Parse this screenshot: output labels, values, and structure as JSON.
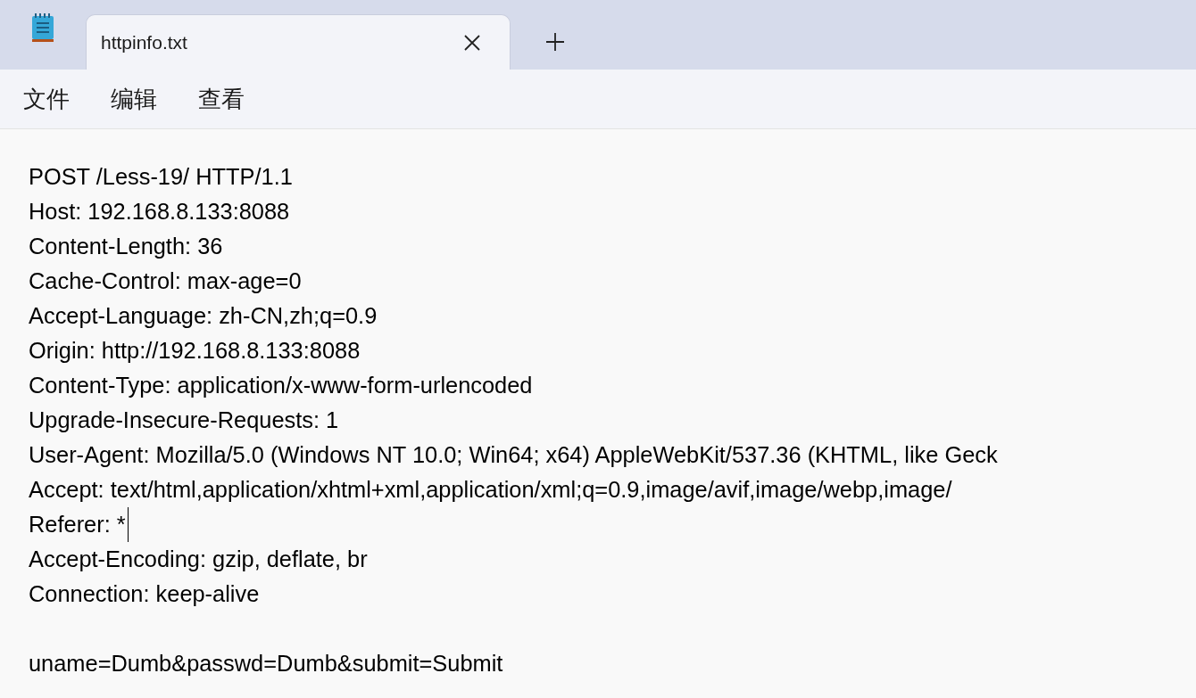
{
  "tabs": [
    {
      "title": "httpinfo.txt",
      "selected": true
    }
  ],
  "menu": [
    "文件",
    "编辑",
    "查看"
  ],
  "editor": {
    "header_lines": [
      {
        "text": "POST /Less-19/ HTTP/1.1",
        "cursor": false
      },
      {
        "text": "Host: 192.168.8.133:8088",
        "cursor": false
      },
      {
        "text": "Content-Length: 36",
        "cursor": false
      },
      {
        "text": "Cache-Control: max-age=0",
        "cursor": false
      },
      {
        "text": "Accept-Language: zh-CN,zh;q=0.9",
        "cursor": false
      },
      {
        "text": "Origin: http://192.168.8.133:8088",
        "cursor": false
      },
      {
        "text": "Content-Type: application/x-www-form-urlencoded",
        "cursor": false
      },
      {
        "text": "Upgrade-Insecure-Requests: 1",
        "cursor": false
      },
      {
        "text": "User-Agent: Mozilla/5.0 (Windows NT 10.0; Win64; x64) AppleWebKit/537.36 (KHTML, like Geck",
        "cursor": false
      },
      {
        "text": "Accept: text/html,application/xhtml+xml,application/xml;q=0.9,image/avif,image/webp,image/",
        "cursor": false
      },
      {
        "text": "Referer: *",
        "cursor": true
      },
      {
        "text": "Accept-Encoding: gzip, deflate, br",
        "cursor": false
      },
      {
        "text": "Connection: keep-alive",
        "cursor": false
      }
    ],
    "body_lines": [
      {
        "text": "uname=Dumb&passwd=Dumb&submit=Submit",
        "cursor": false
      }
    ]
  }
}
